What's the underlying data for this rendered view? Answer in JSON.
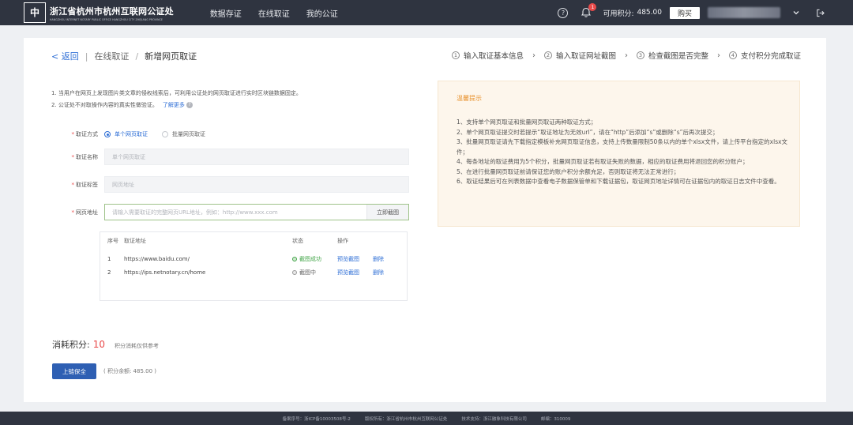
{
  "header": {
    "logo_mark": "中",
    "org_name": "浙江省杭州市杭州互联网公证处",
    "org_name_en": "HANGZHOU INTERNET NOTARY PUBLIC OFFICE HANGZHOU CITY ZHEJIANG PROVINCE",
    "nav": [
      "数据存证",
      "在线取证",
      "我的公证"
    ],
    "notification_count": "1",
    "points_label": "可用积分:",
    "points_value": "485.00",
    "buy_label": "购买"
  },
  "breadcrumb": {
    "back": "< 返回",
    "parent": "在线取证",
    "current": "新增网页取证"
  },
  "steps": [
    {
      "num": "1",
      "label": "输入取证基本信息"
    },
    {
      "num": "2",
      "label": "输入取证网址截图"
    },
    {
      "num": "3",
      "label": "检查截图是否完整"
    },
    {
      "num": "4",
      "label": "支付积分完成取证"
    }
  ],
  "notes": {
    "line1": "1. 当用户在网页上发现图片类文章的侵权线索后，可利用公证处的网页取证进行实时区块链数据固定。",
    "line2": "2. 公证处不对取操作内容的真实性做验证。",
    "learn_more": "了解更多",
    "help_mark": "?"
  },
  "form": {
    "mode_label": "取证方式",
    "mode_options": [
      "单个网页取证",
      "批量网页取证"
    ],
    "name_label": "取证名称",
    "name_placeholder": "单个网页取证",
    "target_label": "取证标签",
    "target_placeholder": "网页地址",
    "url_label": "网页地址",
    "url_placeholder": "请输入需要取证的完整网页URL地址，例如：http://www.xxx.com",
    "url_button": "立即截图"
  },
  "table": {
    "headers": [
      "序号",
      "取证地址",
      "状态",
      "操作"
    ],
    "rows": [
      {
        "no": "1",
        "url": "https://www.baidu.com/",
        "status": "截图成功",
        "status_type": "ok",
        "preview": "预览截图",
        "delete": "删除"
      },
      {
        "no": "2",
        "url": "https://ips.netnotary.cn/home",
        "status": "截图中",
        "status_type": "processing",
        "preview": "预览截图",
        "delete": "删除"
      }
    ]
  },
  "tips": {
    "title": "温馨提示",
    "items": [
      "1、支持单个网页取证和批量网页取证两种取证方式；",
      "2、单个网页取证提交时若提示“取证地址为无效url”，请在“http”后添加“s”或删除“s”后再次提交；",
      "3、批量网页取证请先下载指定模板补充网页取证信息，支持上传数量限制50条以内的单个xlsx文件，请上传平台指定的xlsx文件；",
      "4、每条地址的取证费用为5个积分，批量网页取证若有取证失败的数据，相应的取证费用将退回您的积分账户；",
      "5、在进行批量网页取证前请保证您的账户积分余额充足，否则取证将无法正常进行；",
      "6、取证结果后可在列表数据中查看电子数据保管单和下载证据包，取证网页地址详情可在证据包内的取证日志文件中查看。"
    ]
  },
  "cost": {
    "label": "消耗积分:",
    "value": "10",
    "note": "积分消耗仅供参考"
  },
  "submit": {
    "label": "上链保全",
    "balance": "( 积分余额: 485.00 )"
  },
  "footer": {
    "items": [
      "备案序号：浙ICP备10003508号-2",
      "版权所有：浙江省杭州市杭州互联网公证处",
      "技术支持：浙江融象科技有限公司",
      "邮编：310009"
    ]
  },
  "colors": {
    "topbar": "#2f3440",
    "accent": "#2f6fd6",
    "danger": "#e94a4a",
    "tip_title": "#e8922e",
    "success": "#44a64a"
  }
}
